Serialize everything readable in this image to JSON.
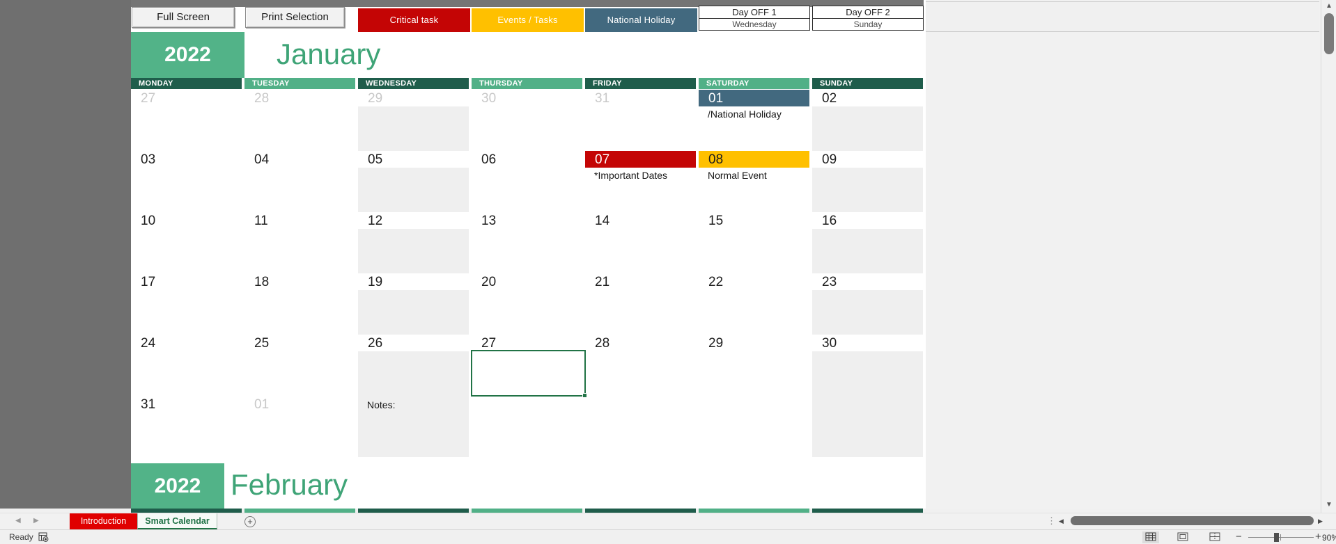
{
  "colors": {
    "critical_red": "#C40505",
    "events_gold": "#FFC000",
    "holiday_blue": "#42697F",
    "header_dark_green": "#1F5D4B",
    "header_light_green": "#51B087",
    "year_badge_green": "#52B388",
    "month_title_green": "#3FA477",
    "excel_green": "#217346",
    "dayoff_column_fill": "#EFEFEF",
    "muted_date": "#C8C8C8",
    "tab_red": "#E00000"
  },
  "toolbar": {
    "full_screen": "Full Screen",
    "print_selection": "Print Selection",
    "legend": [
      {
        "label": "Critical task",
        "color_key": "critical_red",
        "text_color": "#FFFFFF"
      },
      {
        "label": "Events / Tasks",
        "color_key": "events_gold",
        "text_color": "#FFFFFF"
      },
      {
        "label": "National Holiday",
        "color_key": "holiday_blue",
        "text_color": "#FFFFFF"
      }
    ],
    "day_off_boxes": [
      {
        "title": "Day OFF 1",
        "value": "Wednesday"
      },
      {
        "title": "Day OFF 2",
        "value": "Sunday"
      }
    ]
  },
  "calendar": {
    "year": "2022",
    "month": "January",
    "day_headers": [
      "MONDAY",
      "TUESDAY",
      "WEDNESDAY",
      "THURSDAY",
      "FRIDAY",
      "SATURDAY",
      "SUNDAY"
    ],
    "day_off_columns": [
      2,
      6
    ],
    "weeks": [
      [
        {
          "d": "27",
          "muted": true
        },
        {
          "d": "28",
          "muted": true
        },
        {
          "d": "29",
          "muted": true
        },
        {
          "d": "30",
          "muted": true
        },
        {
          "d": "31",
          "muted": true
        },
        {
          "d": "01",
          "type": "holiday",
          "event": "/National Holiday"
        },
        {
          "d": "02"
        }
      ],
      [
        {
          "d": "03"
        },
        {
          "d": "04"
        },
        {
          "d": "05"
        },
        {
          "d": "06"
        },
        {
          "d": "07",
          "type": "critical",
          "event": "*Important Dates"
        },
        {
          "d": "08",
          "type": "event",
          "event": "Normal Event"
        },
        {
          "d": "09"
        }
      ],
      [
        {
          "d": "10"
        },
        {
          "d": "11"
        },
        {
          "d": "12"
        },
        {
          "d": "13"
        },
        {
          "d": "14"
        },
        {
          "d": "15"
        },
        {
          "d": "16"
        }
      ],
      [
        {
          "d": "17"
        },
        {
          "d": "18"
        },
        {
          "d": "19"
        },
        {
          "d": "20"
        },
        {
          "d": "21"
        },
        {
          "d": "22"
        },
        {
          "d": "23"
        }
      ],
      [
        {
          "d": "24"
        },
        {
          "d": "25"
        },
        {
          "d": "26"
        },
        {
          "d": "27"
        },
        {
          "d": "28"
        },
        {
          "d": "29"
        },
        {
          "d": "30"
        }
      ],
      [
        {
          "d": "31"
        },
        {
          "d": "01",
          "muted": true
        },
        {
          "note": "Notes:"
        },
        {},
        {},
        {},
        {}
      ]
    ],
    "selected_cell": {
      "week_index": 4,
      "col_index": 3
    }
  },
  "next_month": {
    "year": "2022",
    "month": "February"
  },
  "sheet_tabs": {
    "tabs": [
      {
        "label": "Introduction",
        "active": false
      },
      {
        "label": "Smart Calendar",
        "active": true
      }
    ]
  },
  "status_bar": {
    "ready": "Ready",
    "zoom": "90%"
  }
}
